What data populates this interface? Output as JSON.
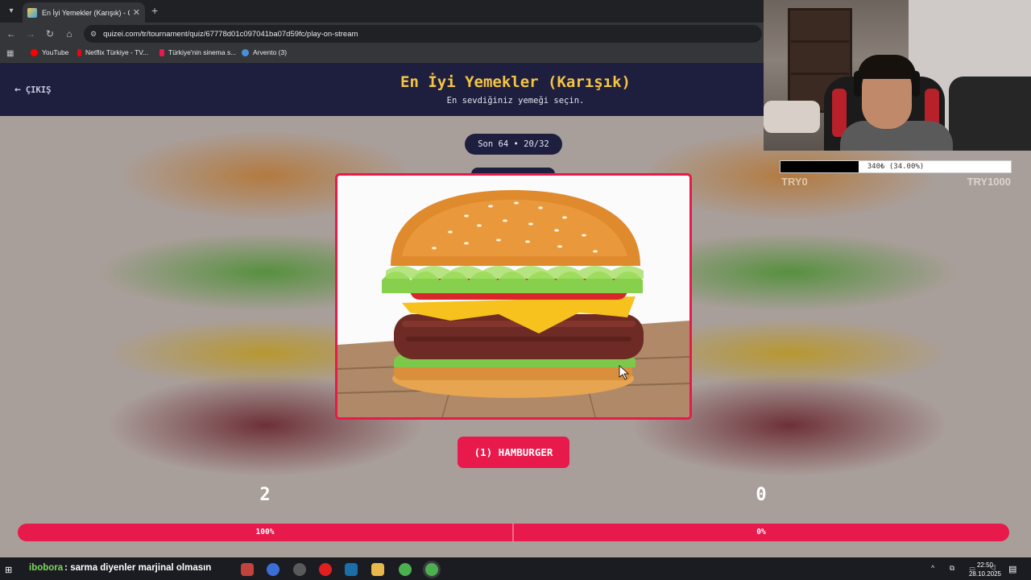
{
  "browser": {
    "tab_title": "En İyi Yemekler (Karışık) - Quizei",
    "url": "quizei.com/tr/tournament/quiz/67778d01c097041ba07d59fc/play-on-stream",
    "bookmarks": [
      {
        "label": "YouTube",
        "color": "#ff0000"
      },
      {
        "label": "Netflix Türkiye - TV...",
        "color": "#e50914"
      },
      {
        "label": "Türkiye'nin sinema s...",
        "color": "#e8194b"
      },
      {
        "label": "Arvento (3)",
        "color": "#4a90d9"
      }
    ]
  },
  "header": {
    "exit_label": "ÇIKIŞ",
    "title": "En İyi Yemekler (Karışık)",
    "subtitle": "En sevdiğiniz yemeği seçin."
  },
  "round": {
    "label": "Son 64 • 20/32"
  },
  "choice": {
    "label": "(1) HAMBURGER",
    "image_icon": "hamburger-photo"
  },
  "scores": {
    "left": "2",
    "right": "0",
    "left_pct": "100%",
    "right_pct": "0%",
    "left_fraction": 1.0
  },
  "overlay": {
    "donation_text": "340₺ (34.00%)",
    "donation_fraction": 0.34,
    "goal_min": "TRY0",
    "goal_max": "TRY1000"
  },
  "taskbar": {
    "chat_user": "ibobora",
    "chat_message": ": sarma diyenler marjinal olmasın",
    "time": "22:50",
    "date": "28.10.2025"
  },
  "colors": {
    "accent": "#e8194b",
    "header_bg": "#1e1f3f",
    "title": "#f5c542"
  }
}
